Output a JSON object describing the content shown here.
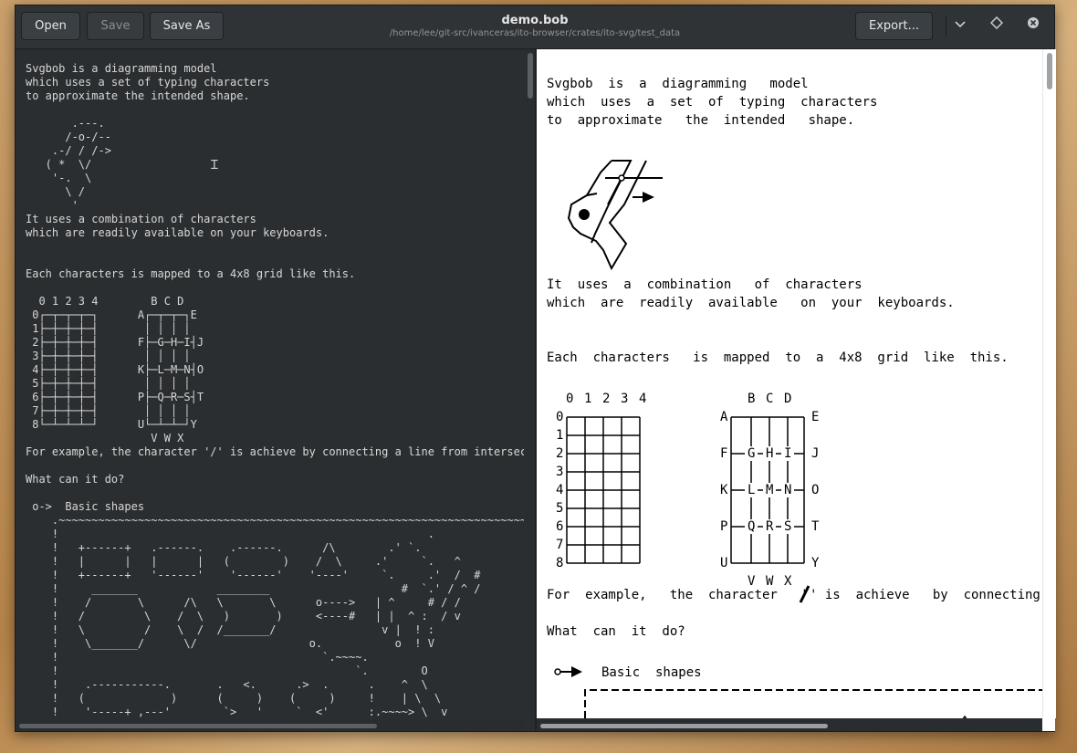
{
  "window": {
    "title": "demo.bob",
    "subtitle": "/home/lee/git-src/ivanceras/ito-browser/crates/ito-svg/test_data"
  },
  "toolbar": {
    "open_label": "Open",
    "save_label": "Save",
    "save_as_label": "Save As",
    "export_label": "Export...",
    "menu_icon": "chevron-down-icon",
    "maximize_icon": "diamond-icon",
    "close_icon": "close-icon"
  },
  "editor": {
    "text": "Svgbob is a diagramming model\nwhich uses a set of typing characters\nto approximate the intended shape.\n\n       .---.\n      /-o-/--\n    .-/ / /->\n   ( *  \\/\n    '-.  \\\n      \\ /\n       '\nIt uses a combination of characters\nwhich are readily available on your keyboards.\n\n\nEach characters is mapped to a 4x8 grid like this.\n\n  0 1 2 3 4        B C D\n 0┌─┬─┬─┬─┐      A┌─┬─┬─┐E\n 1├─┼─┼─┼─┤       │ │ │ │\n 2├─┼─┼─┼─┤      F├─G─H─I┤J\n 3├─┼─┼─┼─┤       │ │ │ │\n 4├─┼─┼─┼─┤      K├─L─M─N┤O\n 5├─┼─┼─┼─┤       │ │ │ │\n 6├─┼─┼─┼─┤      P├─Q─R─S┤T\n 7├─┼─┼─┼─┤       │ │ │ │\n 8└─┴─┴─┴─┘      U└─┴─┴─┘Y\n                   V W X\nFor example, the character '/' is achieve by connecting a line from intersecti\n\nWhat can it do?\n\n o->  Basic shapes\n    .~~~~~~~~~~~~~~~~~~~~~~~~~~~~~~~~~~~~~~~~~~~~~~~~~~~~~~~~~~~~~~~~~~~~~~~~.\n    !                                                        .                :\n    !   +------+   .------.    .------.      /\\        .' `.                 :\n    !   |      |   |      |   (        )    /  \\     .'     `.   ^            :\n    !   +------+   '------'    '------'    '----'     `.     .'  /  #          :\n    !     _______            ________                    #  `.' / ^ /          :\n    !    /       \\      /\\   \\       \\      o---->   | ^     # / /            :\n    !   /         \\    /  \\   )       )     <----#   | |  ^ :  / v            :\n    !   \\         /    \\  /  /_______/                v |  ! :                 :\n    !    \\_______/      \\/                 o.           o  ! V                 :\n    !                                        `.~~~~.                          :\n    !                                             `.        O                 :\n    !    .-----------.       .   <.      .>  .      .    ^  \\                 :\n    !   (             )      (     )    (     )     !    | \\  \\               :\n    !    '-----+ ,---'        `>   '     `  <'      :.~~~~> \\  v              :"
  },
  "preview": {
    "lines": [
      "Svgbob  is  a  diagramming   model",
      "which  uses  a  set  of  typing  characters",
      "to  approximate   the  intended   shape.",
      "It  uses  a  combination   of  characters",
      "which  are  readily  available   on  your  keyboards.",
      "Each  characters   is  mapped  to  a  4x8  grid  like  this.",
      "For  example,   the  character   '",
      "' is  achieve   by  connecting",
      "What  can  it  do?",
      "Basic  shapes"
    ],
    "grid_col_headers": [
      "0",
      "1",
      "2",
      "3",
      "4"
    ],
    "grid_row_headers": [
      "0",
      "1",
      "2",
      "3",
      "4",
      "5",
      "6",
      "7",
      "8"
    ],
    "letter_top": [
      "B",
      "C",
      "D"
    ],
    "letter_bottom": [
      "V",
      "W",
      "X"
    ],
    "letter_left": [
      "A",
      "F",
      "K",
      "P",
      "U"
    ],
    "letter_right": [
      "E",
      "J",
      "O",
      "T",
      "Y"
    ],
    "letter_inner": [
      [
        "G",
        "H",
        "I"
      ],
      [
        "L",
        "M",
        "N"
      ],
      [
        "Q",
        "R",
        "S"
      ]
    ]
  }
}
